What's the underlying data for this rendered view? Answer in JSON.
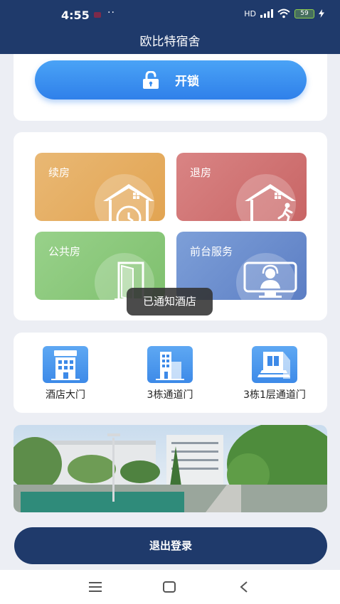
{
  "status_bar": {
    "time": "4:55",
    "dots": "··",
    "network": "HD",
    "battery": "59"
  },
  "header": {
    "title": "欧比特宿舍"
  },
  "unlock": {
    "label": "开锁",
    "icon": "unlock-icon"
  },
  "services": [
    {
      "label": "续房",
      "icon": "house-clock-icon"
    },
    {
      "label": "退房",
      "icon": "house-exit-icon"
    },
    {
      "label": "公共房",
      "icon": "door-icon"
    },
    {
      "label": "前台服务",
      "icon": "reception-icon"
    }
  ],
  "toast": {
    "text": "已通知酒店"
  },
  "doors": [
    {
      "label": "酒店大门",
      "icon": "hotel-icon"
    },
    {
      "label": "3栋通道门",
      "icon": "building-icon"
    },
    {
      "label": "3栋1层通道门",
      "icon": "gate-icon"
    }
  ],
  "banner": {
    "icon": "campus-photo"
  },
  "logout": {
    "label": "退出登录"
  },
  "colors": {
    "primary": "#1f3a6b",
    "unlock": "#3a8ef0",
    "renew": "#e5ad60",
    "checkout": "#cf7272",
    "public": "#8ac87b",
    "front": "#6a8ccd"
  },
  "nav": {
    "menu_icon": "menu-icon",
    "home_icon": "home-icon",
    "back_icon": "back-icon"
  }
}
